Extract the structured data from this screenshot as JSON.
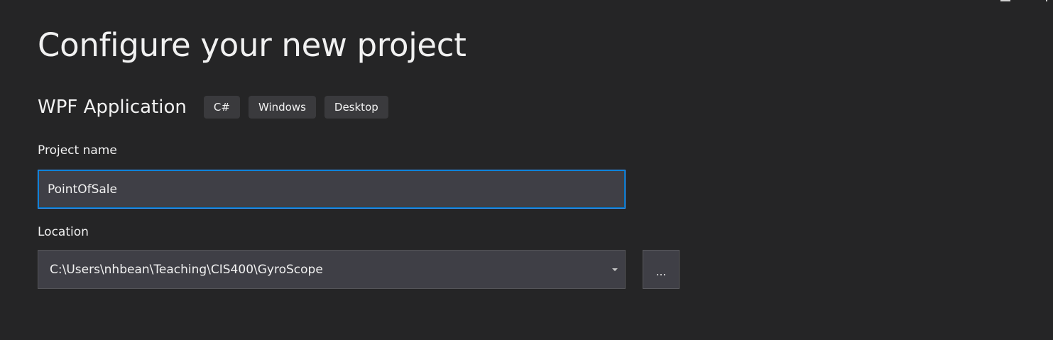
{
  "header": {
    "title": "Configure your new project"
  },
  "template": {
    "name": "WPF Application",
    "tags": [
      "C#",
      "Windows",
      "Desktop"
    ]
  },
  "project_name": {
    "label": "Project name",
    "value": "PointOfSale"
  },
  "location": {
    "label": "Location",
    "value": "C:\\Users\\nhbean\\Teaching\\CIS400\\GyroScope",
    "browse_label": "..."
  },
  "colors": {
    "background": "#252526",
    "input_background": "#3f3f46",
    "focus_border": "#3399ff",
    "tag_background": "#3a3a3d",
    "text": "#f1f1f1"
  }
}
